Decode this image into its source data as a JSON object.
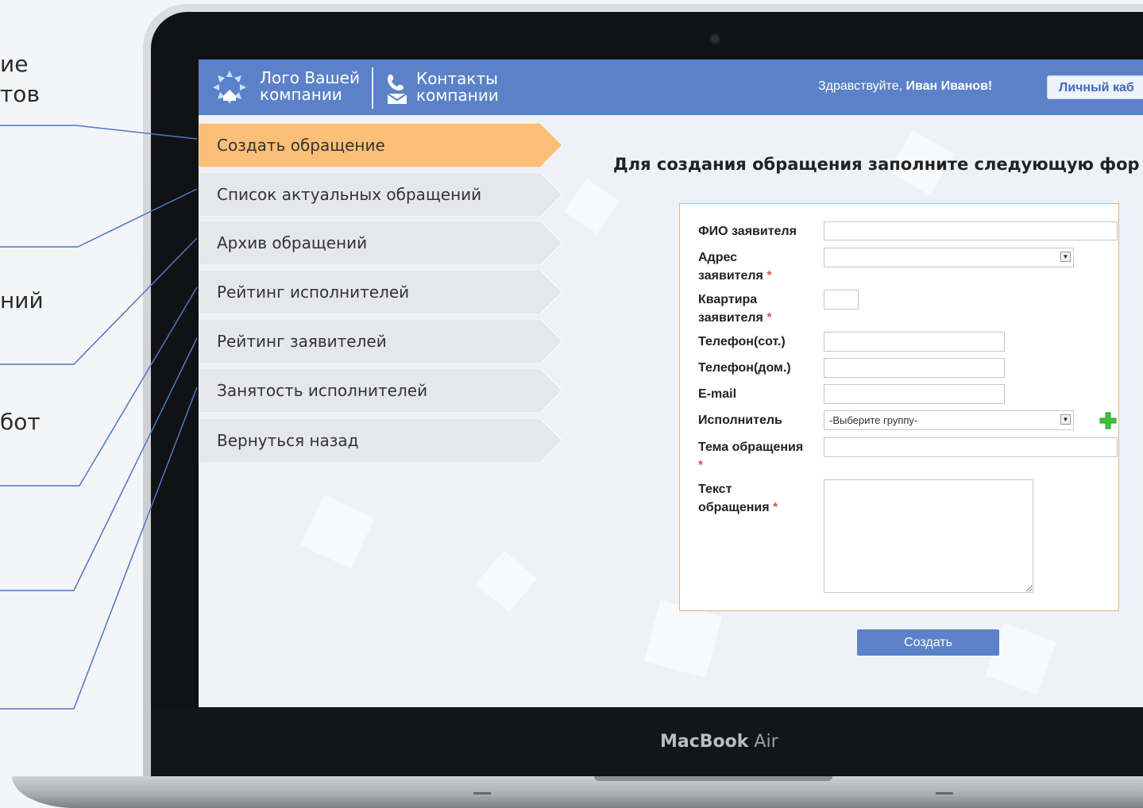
{
  "callouts": [
    "ие\nтов",
    "ний",
    "бот"
  ],
  "header": {
    "logo_line1": "Лого Вашей",
    "logo_line2": "компании",
    "contacts_line1": "Контакты",
    "contacts_line2": "компании",
    "greeting": "Здравствуйте, ",
    "user_name": "Иван Иванов!",
    "cabinet_button": "Личный каб"
  },
  "menu": {
    "items": [
      {
        "label": "Создать обращение",
        "active": true
      },
      {
        "label": "Список актуальных обращений",
        "active": false
      },
      {
        "label": "Архив обращений",
        "active": false
      },
      {
        "label": "Рейтинг исполнителей",
        "active": false
      },
      {
        "label": "Рейтинг заявителей",
        "active": false
      },
      {
        "label": "Занятость исполнителей",
        "active": false
      },
      {
        "label": "Вернуться назад",
        "active": false
      }
    ]
  },
  "form": {
    "title": "Для создания обращения заполните следующую фор",
    "required_mark": "*",
    "fields": {
      "fio": {
        "label": "ФИО заявителя",
        "value": ""
      },
      "address": {
        "label_line1": "Адрес",
        "label_line2": "заявителя",
        "value": ""
      },
      "apartment": {
        "label_line1": "Квартира",
        "label_line2": "заявителя",
        "value": ""
      },
      "phone_mobile": {
        "label": "Телефон(сот.)",
        "value": ""
      },
      "phone_home": {
        "label": "Телефон(дом.)",
        "value": ""
      },
      "email": {
        "label": "E-mail",
        "value": ""
      },
      "executor": {
        "label": "Исполнитель",
        "selected": "-Выберите группу-"
      },
      "subject": {
        "label": "Тема обращения",
        "value": ""
      },
      "text": {
        "label_line1": "Текст",
        "label_line2": "обращения",
        "value": ""
      }
    },
    "submit_label": "Создать"
  },
  "laptop": {
    "brand_bold": "MacBook",
    "brand_light": " Air"
  },
  "colors": {
    "header": "#5b82c9",
    "active_menu": "#fbbf78",
    "menu": "#e6e7ea",
    "required": "#d9534f",
    "plus": "#3cc23c"
  }
}
